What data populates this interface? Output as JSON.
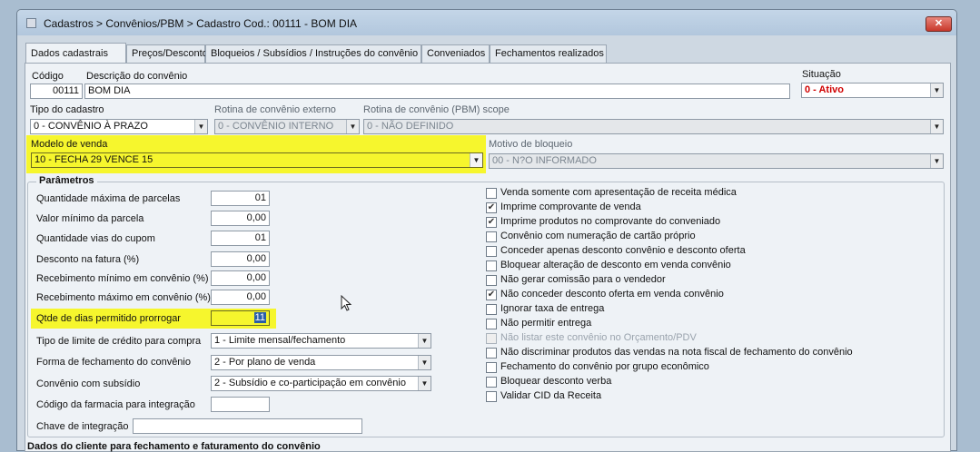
{
  "window": {
    "title": "Cadastros > Convênios/PBM > Cadastro  Cod.: 00111 - BOM DIA",
    "close_label": "✕"
  },
  "tabs": [
    {
      "label": "Dados cadastrais"
    },
    {
      "label": "Preços/Descontos"
    },
    {
      "label": "Bloqueios / Subsídios / Instruções do convênio"
    },
    {
      "label": "Conveniados"
    },
    {
      "label": "Fechamentos realizados"
    }
  ],
  "form": {
    "codigo_label": "Código",
    "codigo_value": "00111",
    "descricao_label": "Descrição do convênio",
    "descricao_value": "BOM DIA",
    "situacao_label": "Situação",
    "situacao_value": "0 - Ativo",
    "tipo_cadastro_label": "Tipo do cadastro",
    "tipo_cadastro_value": "0 - CONVÊNIO À PRAZO",
    "rotina_externo_label": "Rotina de convênio externo",
    "rotina_externo_value": "0 - CONVÊNIO INTERNO",
    "rotina_pbm_label": "Rotina de convênio (PBM) scope",
    "rotina_pbm_value": "0 - NÃO DEFINIDO",
    "modelo_venda_label": "Modelo de venda",
    "modelo_venda_value": "10 - FECHA 29 VENCE 15",
    "motivo_bloqueio_label": "Motivo de bloqueio",
    "motivo_bloqueio_value": "00 - N?O INFORMADO"
  },
  "parametros": {
    "legend": "Parâmetros",
    "fields": [
      {
        "label": "Quantidade máxima de parcelas",
        "value": "01"
      },
      {
        "label": "Valor mínimo da parcela",
        "value": "0,00"
      },
      {
        "label": "Quantidade vias do cupom",
        "value": "01"
      },
      {
        "label": "Desconto na fatura (%)",
        "value": "0,00"
      },
      {
        "label": "Recebimento mínimo em convênio (%)",
        "value": "0,00"
      },
      {
        "label": "Recebimento máximo em convênio (%)",
        "value": "0,00"
      },
      {
        "label": "Qtde de dias permitido prorrogar",
        "value": "11"
      }
    ],
    "tipo_limite_label": "Tipo de limite de crédito para compra",
    "tipo_limite_value": "1 - Limite mensal/fechamento",
    "forma_fechamento_label": "Forma de fechamento do convênio",
    "forma_fechamento_value": "2 - Por plano de venda",
    "subsidio_label": "Convênio com subsídio",
    "subsidio_value": "2 - Subsídio e co-participação em convênio",
    "codigo_farmacia_label": "Código da farmacia para integração",
    "codigo_farmacia_value": "",
    "chave_label": "Chave de integração",
    "chave_value": ""
  },
  "checkboxes": [
    {
      "label": "Venda somente com apresentação de receita médica",
      "checked": false,
      "disabled": false
    },
    {
      "label": "Imprime comprovante de venda",
      "checked": true,
      "disabled": false
    },
    {
      "label": "Imprime produtos no comprovante do conveniado",
      "checked": true,
      "disabled": false
    },
    {
      "label": "Convênio com numeração de cartão próprio",
      "checked": false,
      "disabled": false
    },
    {
      "label": "Conceder apenas desconto convênio e desconto oferta",
      "checked": false,
      "disabled": false
    },
    {
      "label": "Bloquear alteração de desconto em venda convênio",
      "checked": false,
      "disabled": false
    },
    {
      "label": "Não gerar comissão para o vendedor",
      "checked": false,
      "disabled": false
    },
    {
      "label": "Não conceder desconto oferta em venda convênio",
      "checked": true,
      "disabled": false
    },
    {
      "label": "Ignorar taxa de entrega",
      "checked": false,
      "disabled": false
    },
    {
      "label": "Não permitir entrega",
      "checked": false,
      "disabled": false
    },
    {
      "label": "Não listar este convênio no Orçamento/PDV",
      "checked": false,
      "disabled": true
    },
    {
      "label": "Não discriminar produtos das vendas na nota fiscal de fechamento do convênio",
      "checked": false,
      "disabled": false
    },
    {
      "label": "Fechamento do convênio por grupo econômico",
      "checked": false,
      "disabled": false
    },
    {
      "label": "Bloquear desconto verba",
      "checked": false,
      "disabled": false
    },
    {
      "label": "Validar CID da Receita",
      "checked": false,
      "disabled": false
    }
  ],
  "bottom_section": {
    "legend": "Dados do cliente para fechamento e faturamento do convênio"
  },
  "colors": {
    "highlight": "#f6f62d",
    "status_red": "#d00000"
  }
}
